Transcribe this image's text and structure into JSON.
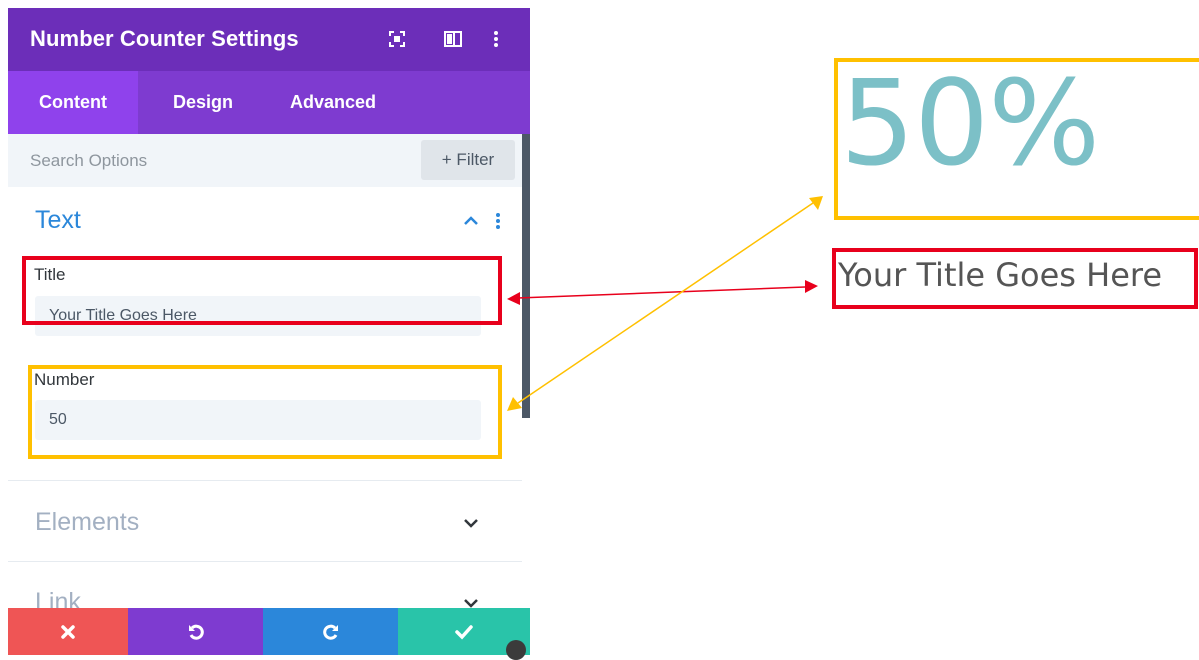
{
  "panel": {
    "title": "Number Counter Settings",
    "header_icons": [
      "expand-icon",
      "sidebar-layout-icon",
      "more-vertical-icon"
    ],
    "tabs": [
      {
        "label": "Content",
        "active": true
      },
      {
        "label": "Design",
        "active": false
      },
      {
        "label": "Advanced",
        "active": false
      }
    ],
    "search": {
      "placeholder": "Search Options",
      "value": ""
    },
    "filter_label": "+ Filter",
    "sections": {
      "text": {
        "title": "Text",
        "expanded": true,
        "title_field": {
          "label": "Title",
          "value": "Your Title Goes Here"
        },
        "number_field": {
          "label": "Number",
          "value": "50"
        }
      },
      "elements": {
        "title": "Elements",
        "expanded": false
      },
      "link": {
        "title": "Link",
        "expanded": false
      }
    },
    "footer_buttons": [
      {
        "name": "discard",
        "icon": "close-icon",
        "color": "#ef5555"
      },
      {
        "name": "undo",
        "icon": "undo-icon",
        "color": "#7e3bd0"
      },
      {
        "name": "redo",
        "icon": "redo-icon",
        "color": "#2b87da"
      },
      {
        "name": "save",
        "icon": "check-icon",
        "color": "#29c4a9"
      }
    ]
  },
  "preview": {
    "number_display": "50%",
    "title_display": "Your Title Goes Here"
  },
  "colors": {
    "header_bg": "#6c2eb9",
    "tab_bar_bg": "#7e3bd0",
    "active_tab_bg": "#8f42ec",
    "section_title_active": "#2b87da",
    "section_title_inactive": "#a3b0c2",
    "highlight_red": "#e8001c",
    "highlight_yellow": "#ffc000",
    "counter_color": "#7cc0c7"
  }
}
